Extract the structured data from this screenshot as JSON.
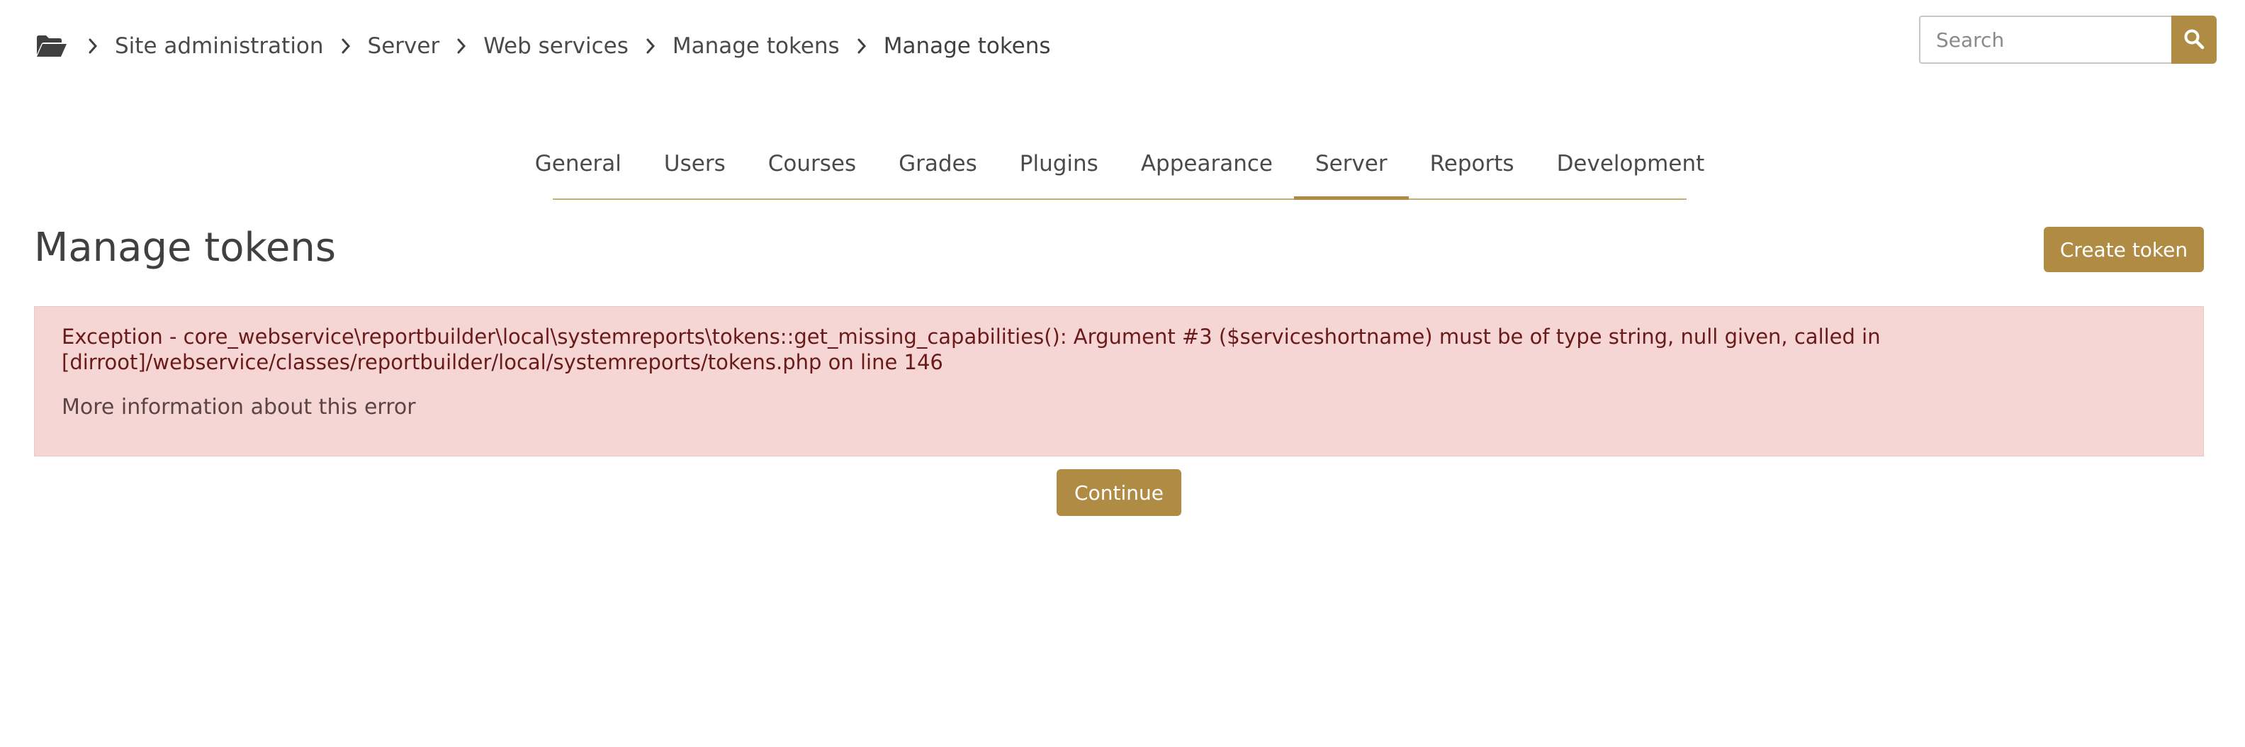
{
  "breadcrumb": {
    "icon": "folder-open-icon",
    "items": [
      "Site administration",
      "Server",
      "Web services",
      "Manage tokens",
      "Manage tokens"
    ]
  },
  "search": {
    "placeholder": "Search",
    "icon": "search-icon"
  },
  "tabs": [
    {
      "label": "General"
    },
    {
      "label": "Users"
    },
    {
      "label": "Courses"
    },
    {
      "label": "Grades"
    },
    {
      "label": "Plugins"
    },
    {
      "label": "Appearance"
    },
    {
      "label": "Server",
      "active": true
    },
    {
      "label": "Reports"
    },
    {
      "label": "Development"
    }
  ],
  "page": {
    "title": "Manage tokens",
    "create_label": "Create token"
  },
  "error": {
    "message": "Exception - core_webservice\\reportbuilder\\local\\systemreports\\tokens::get_missing_capabilities(): Argument #3 ($serviceshortname) must be of type string, null given, called in [dirroot]/webservice/classes/reportbuilder/local/systemreports/tokens.php on line 146",
    "more_info": "More information about this error"
  },
  "actions": {
    "continue_label": "Continue"
  },
  "colors": {
    "accent": "#b08b43",
    "error_bg": "#f5d6d4",
    "error_text": "#6b1a1a",
    "text": "#404041"
  }
}
